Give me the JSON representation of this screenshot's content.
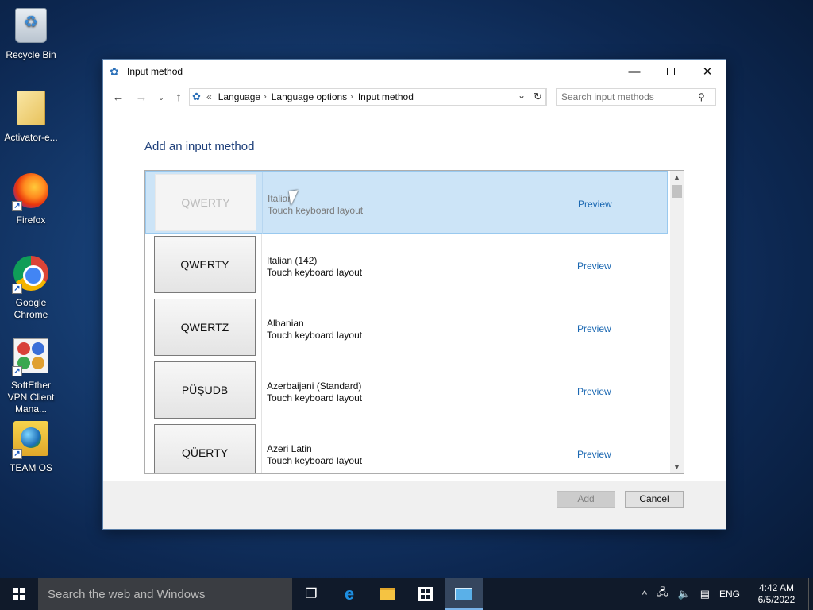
{
  "desktop": {
    "icons": [
      {
        "label": "Recycle Bin"
      },
      {
        "label": "Activator-e..."
      },
      {
        "label": "Firefox"
      },
      {
        "label": "Google Chrome"
      },
      {
        "label": "SoftEther VPN Client Mana..."
      },
      {
        "label": "TEAM OS"
      }
    ]
  },
  "window": {
    "title": "Input method",
    "controls": {
      "minimize": "—",
      "maximize": "",
      "close": "✕"
    },
    "nav": {
      "back": "←",
      "forward": "→",
      "recent": "⌄",
      "up": "↑"
    },
    "address": {
      "prefix": "«",
      "crumbs": [
        "Language",
        "Language options",
        "Input method"
      ],
      "separator": "›"
    },
    "search_placeholder": "Search input methods",
    "heading": "Add an input method",
    "list": [
      {
        "layout": "QWERTY",
        "name": "Italian",
        "sub": "Touch keyboard layout",
        "preview": "Preview",
        "selected": true
      },
      {
        "layout": "QWERTY",
        "name": "Italian (142)",
        "sub": "Touch keyboard layout",
        "preview": "Preview",
        "selected": false
      },
      {
        "layout": "QWERTZ",
        "name": "Albanian",
        "sub": "Touch keyboard layout",
        "preview": "Preview",
        "selected": false
      },
      {
        "layout": "PÜŞUDB",
        "name": "Azerbaijani (Standard)",
        "sub": "Touch keyboard layout",
        "preview": "Preview",
        "selected": false
      },
      {
        "layout": "QÜERTY",
        "name": "Azeri Latin",
        "sub": "Touch keyboard layout",
        "preview": "Preview",
        "selected": false
      }
    ],
    "buttons": {
      "add": "Add",
      "cancel": "Cancel"
    }
  },
  "taskbar": {
    "search_placeholder": "Search the web and Windows",
    "tray": {
      "lang": "ENG",
      "time": "4:42 AM",
      "date": "6/5/2022"
    }
  },
  "colors": {
    "accent": "#1b68b2",
    "selection": "#cce4f7",
    "heading": "#1e3f7a"
  }
}
